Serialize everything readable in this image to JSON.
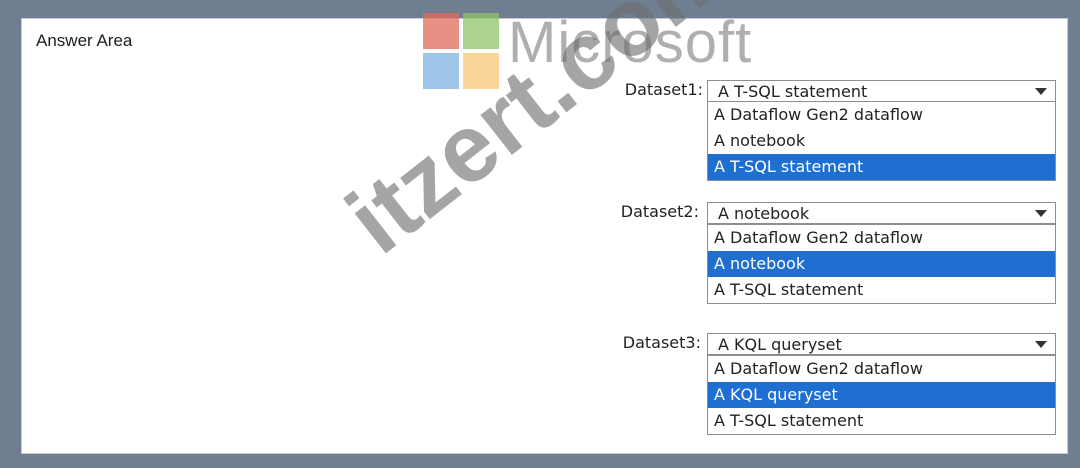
{
  "answer_area": {
    "title": "Answer Area"
  },
  "watermark": {
    "brand": "Microsoft",
    "diagonal": "itzert.com",
    "logo_colors": [
      "#e06b5a",
      "#8fc36a",
      "#7fb1e0",
      "#f7c774"
    ]
  },
  "datasets": [
    {
      "label": "Dataset1:",
      "selected_value": "A T-SQL statement",
      "options": [
        "A Dataflow Gen2 dataflow",
        "A notebook",
        "A T-SQL statement"
      ],
      "highlighted": "A T-SQL statement"
    },
    {
      "label": "Dataset2:",
      "selected_value": "A notebook",
      "options": [
        "A Dataflow Gen2 dataflow",
        "A notebook",
        "A T-SQL statement"
      ],
      "highlighted": "A notebook"
    },
    {
      "label": "Dataset3:",
      "selected_value": "A KQL queryset",
      "options": [
        "A Dataflow Gen2 dataflow",
        "A KQL queryset",
        "A T-SQL statement"
      ],
      "highlighted": "A KQL queryset"
    }
  ],
  "colors": {
    "selection": "#1e6fd0",
    "frame": "#6f7f91"
  }
}
